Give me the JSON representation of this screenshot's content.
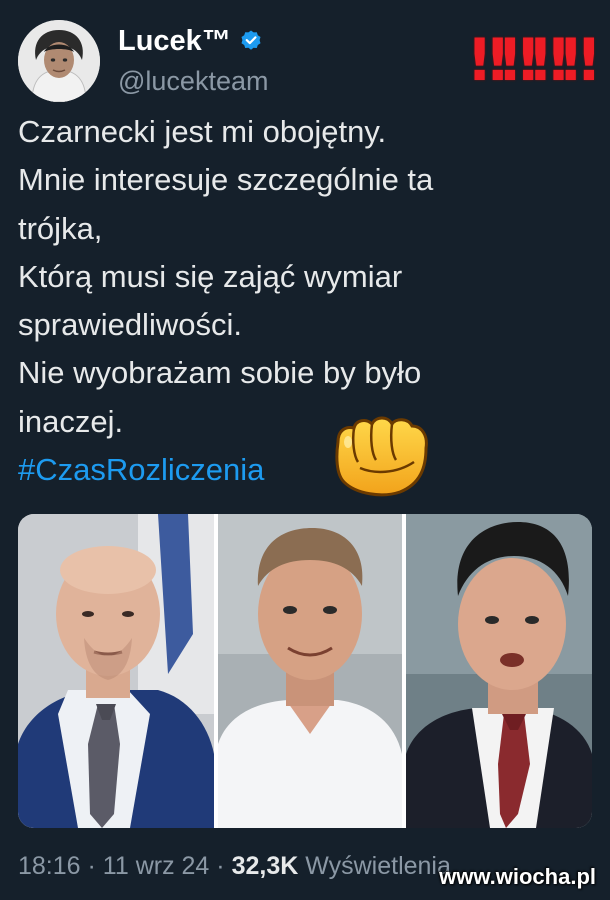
{
  "user": {
    "display_name": "Lucek™",
    "handle": "@lucekteam",
    "verified": true
  },
  "overlay": {
    "exclamations": "‼‼‼‼",
    "exclamation_color": "#ee1c25"
  },
  "tweet": {
    "lines": [
      "Czarnecki jest mi obojętny.",
      "Mnie interesuje szczególnie ta",
      "trójka,",
      "Którą musi się zająć wymiar",
      "sprawiedliwości.",
      "Nie wyobrażam sobie by było",
      "inaczej."
    ],
    "hashtag": "#CzasRozliczenia",
    "emoji": "oncoming-fist"
  },
  "media": {
    "panels": 3
  },
  "meta": {
    "time": "18:16",
    "separator": "·",
    "date": "11 wrz 24",
    "views_count": "32,3K",
    "views_label": "Wyświetlenia"
  },
  "watermark": {
    "text": "www.wiocha.pl"
  },
  "colors": {
    "background": "#15202b",
    "text": "#e7e9ea",
    "secondary": "#8b98a5",
    "link": "#1d9bf0",
    "verified": "#1d9bf0"
  }
}
